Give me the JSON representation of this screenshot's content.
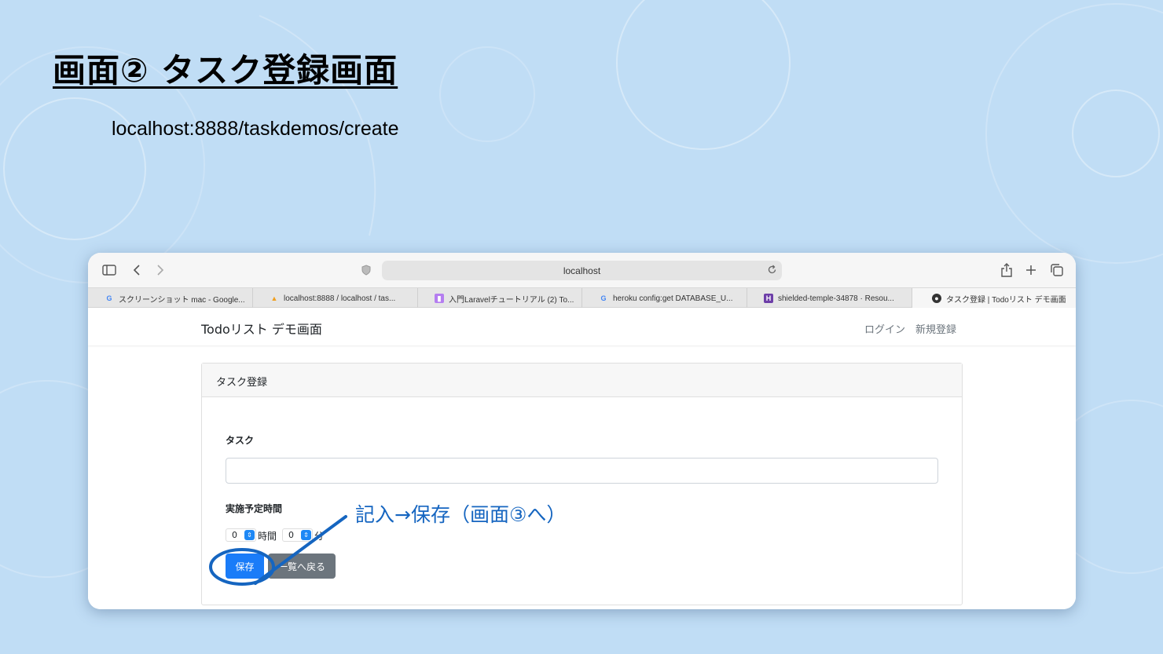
{
  "slide": {
    "title": "画面② タスク登録画面",
    "url_text": "localhost:8888/taskdemos/create",
    "callout": "記入→保存（画面③へ）"
  },
  "browser": {
    "address": "localhost",
    "icons": {
      "sidebar": "sidebar-icon",
      "back": "chevron-left-icon",
      "forward": "chevron-right-icon",
      "shield": "shield-icon",
      "reload": "reload-icon",
      "share": "share-icon",
      "new_tab": "plus-icon",
      "tab_overview": "tabs-icon"
    },
    "tabs": [
      {
        "label": "スクリーンショット mac - Google...",
        "favicon": "google-icon"
      },
      {
        "label": "localhost:8888 / localhost / tas...",
        "favicon": "phpmyadmin-icon"
      },
      {
        "label": "入門Laravelチュートリアル (2) To...",
        "favicon": "qiita-icon"
      },
      {
        "label": "heroku config:get DATABASE_U...",
        "favicon": "google-icon"
      },
      {
        "label": "shielded-temple-34878 · Resou...",
        "favicon": "heroku-icon"
      },
      {
        "label": "タスク登録 | Todoリスト デモ画面",
        "favicon": "github-icon"
      }
    ]
  },
  "app": {
    "brand": "Todoリスト デモ画面",
    "nav": {
      "login": "ログイン",
      "register": "新規登録"
    },
    "card_title": "タスク登録",
    "task_label": "タスク",
    "task_value": "",
    "time_label": "実施予定時間",
    "hours_value": "0",
    "hours_unit": "時間",
    "minutes_value": "0",
    "minutes_unit": "分",
    "save_label": "保存",
    "back_label": "一覧へ戻る"
  },
  "colors": {
    "background": "#c0ddf5",
    "primary_button": "#1a7cf8",
    "secondary_button": "#6c757d",
    "annotation": "#1565c0"
  }
}
